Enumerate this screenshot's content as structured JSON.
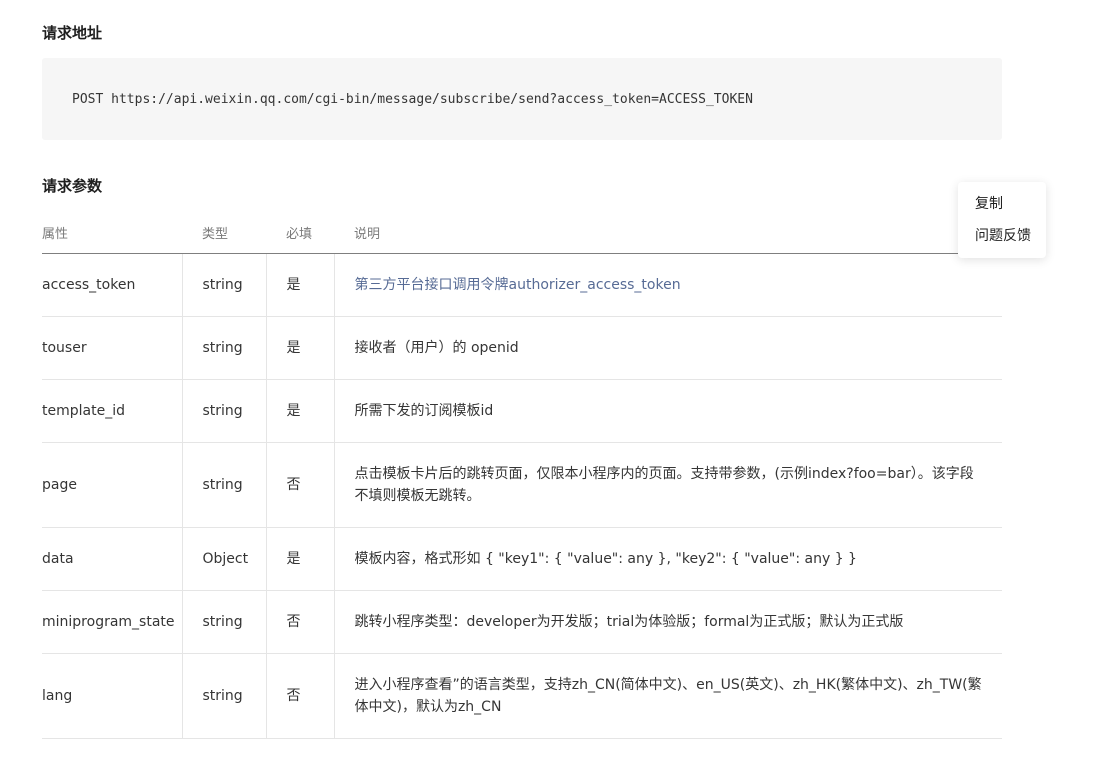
{
  "request_url": {
    "title": "请求地址",
    "code": "POST https://api.weixin.qq.com/cgi-bin/message/subscribe/send?access_token=ACCESS_TOKEN"
  },
  "request_params": {
    "title": "请求参数",
    "headers": [
      "属性",
      "类型",
      "必填",
      "说明"
    ],
    "rows": [
      {
        "name": "access_token",
        "type": "string",
        "required": "是",
        "desc": "第三方平台接口调用令牌authorizer_access_token"
      },
      {
        "name": "touser",
        "type": "string",
        "required": "是",
        "desc": "接收者（用户）的 openid"
      },
      {
        "name": "template_id",
        "type": "string",
        "required": "是",
        "desc": "所需下发的订阅模板id"
      },
      {
        "name": "page",
        "type": "string",
        "required": "否",
        "desc": "点击模板卡片后的跳转页面，仅限本小程序内的页面。支持带参数，(示例index?foo=bar）。该字段不填则模板无跳转。"
      },
      {
        "name": "data",
        "type": "Object",
        "required": "是",
        "desc": "模板内容，格式形如 { \"key1\": { \"value\": any }, \"key2\": { \"value\": any } }"
      },
      {
        "name": "miniprogram_state",
        "type": "string",
        "required": "否",
        "desc": "跳转小程序类型：developer为开发版；trial为体验版；formal为正式版；默认为正式版"
      },
      {
        "name": "lang",
        "type": "string",
        "required": "否",
        "desc": "进入小程序查看”的语言类型，支持zh_CN(简体中文)、en_US(英文)、zh_HK(繁体中文)、zh_TW(繁体中文)，默认为zh_CN"
      }
    ]
  },
  "context_menu": {
    "items": [
      "复制",
      "问题反馈"
    ]
  },
  "colors": {
    "link": "#576b95",
    "code_bg": "#f6f6f6"
  }
}
